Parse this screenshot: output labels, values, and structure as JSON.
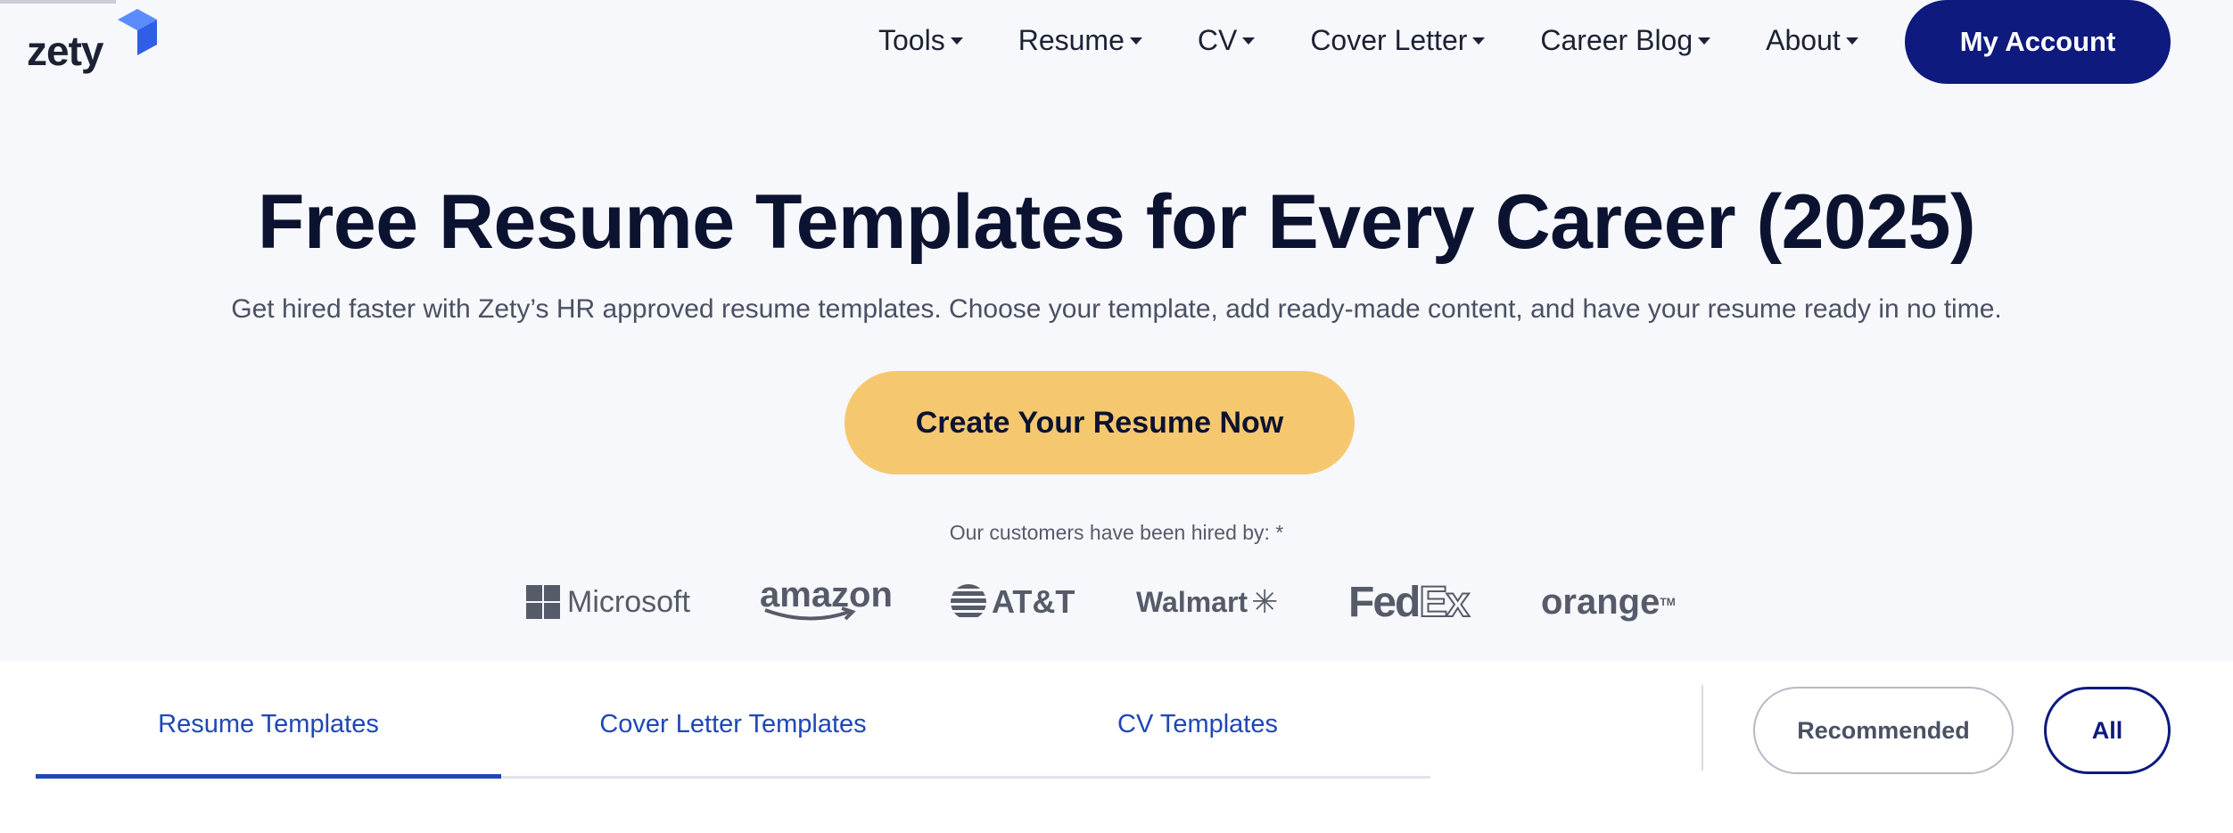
{
  "header": {
    "logo_text": "zety",
    "nav": [
      {
        "label": "Tools"
      },
      {
        "label": "Resume"
      },
      {
        "label": "CV"
      },
      {
        "label": "Cover Letter"
      },
      {
        "label": "Career Blog"
      },
      {
        "label": "About"
      }
    ],
    "account_label": "My Account"
  },
  "hero": {
    "title": "Free Resume Templates for Every Career (2025)",
    "subtitle": "Get hired faster with Zety’s HR approved resume templates. Choose your template, add ready-made content, and have your resume ready in no time.",
    "cta_label": "Create Your Resume Now",
    "hired_label": "Our customers have been hired by: *"
  },
  "brands": {
    "microsoft": "Microsoft",
    "amazon": "amazon",
    "att": "AT&T",
    "walmart": "Walmart",
    "fedex_fed": "Fed",
    "fedex_ex": "Ex",
    "orange": "orange",
    "orange_tm": "TM"
  },
  "tabs": [
    {
      "label": "Resume Templates",
      "active": true
    },
    {
      "label": "Cover Letter Templates",
      "active": false
    },
    {
      "label": "CV Templates",
      "active": false
    }
  ],
  "filters": {
    "recommended": "Recommended",
    "all": "All"
  },
  "colors": {
    "brand_navy": "#0e1a7e",
    "cta_yellow": "#f5c870",
    "tab_blue": "#1f47b6",
    "logo_blue": "#3b6ef5"
  }
}
